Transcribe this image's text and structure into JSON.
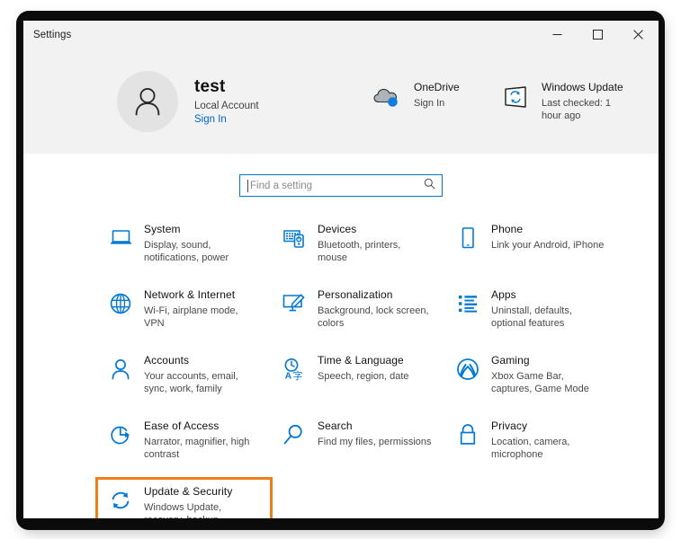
{
  "window": {
    "title": "Settings",
    "controls": [
      {
        "name": "minimize",
        "glyph": "minimize-icon"
      },
      {
        "name": "maximize",
        "glyph": "maximize-icon"
      },
      {
        "name": "close",
        "glyph": "close-icon"
      }
    ]
  },
  "header": {
    "account": {
      "avatar_icon": "person-avatar-icon",
      "name": "test",
      "account_type": "Local Account",
      "sign_in_link": "Sign In"
    },
    "onedrive": {
      "icon": "onedrive-cloud-icon",
      "title": "OneDrive",
      "subtitle": "Sign In"
    },
    "windows_update": {
      "icon": "windows-update-sync-icon",
      "title": "Windows Update",
      "subtitle": "Last checked: 1 hour ago"
    }
  },
  "search": {
    "placeholder": "Find a setting",
    "value": "",
    "icon": "search-icon",
    "focused": true
  },
  "tiles": [
    {
      "icon": "laptop-icon",
      "title": "System",
      "subtitle": "Display, sound, notifications, power",
      "highlighted": false
    },
    {
      "icon": "devices-keyboard-icon",
      "title": "Devices",
      "subtitle": "Bluetooth, printers, mouse",
      "highlighted": false
    },
    {
      "icon": "phone-icon",
      "title": "Phone",
      "subtitle": "Link your Android, iPhone",
      "highlighted": false
    },
    {
      "icon": "globe-icon",
      "title": "Network & Internet",
      "subtitle": "Wi-Fi, airplane mode, VPN",
      "highlighted": false
    },
    {
      "icon": "personalization-brush-icon",
      "title": "Personalization",
      "subtitle": "Background, lock screen, colors",
      "highlighted": false
    },
    {
      "icon": "apps-list-icon",
      "title": "Apps",
      "subtitle": "Uninstall, defaults, optional features",
      "highlighted": false
    },
    {
      "icon": "person-icon",
      "title": "Accounts",
      "subtitle": "Your accounts, email, sync, work, family",
      "highlighted": false
    },
    {
      "icon": "clock-language-icon",
      "title": "Time & Language",
      "subtitle": "Speech, region, date",
      "highlighted": false
    },
    {
      "icon": "xbox-gaming-icon",
      "title": "Gaming",
      "subtitle": "Xbox Game Bar, captures, Game Mode",
      "highlighted": false
    },
    {
      "icon": "ease-of-access-clock-arrow-icon",
      "title": "Ease of Access",
      "subtitle": "Narrator, magnifier, high contrast",
      "highlighted": false
    },
    {
      "icon": "search-magnifier-icon",
      "title": "Search",
      "subtitle": "Find my files, permissions",
      "highlighted": false
    },
    {
      "icon": "lock-icon",
      "title": "Privacy",
      "subtitle": "Location, camera, microphone",
      "highlighted": false
    },
    {
      "icon": "update-security-refresh-icon",
      "title": "Update & Security",
      "subtitle": "Windows Update, recovery, backup",
      "highlighted": true
    }
  ],
  "colors": {
    "accent_blue": "#0078d4",
    "highlight_orange": "#f07f1a",
    "header_band": "#f2f2f2",
    "link_blue": "#0066cc"
  }
}
